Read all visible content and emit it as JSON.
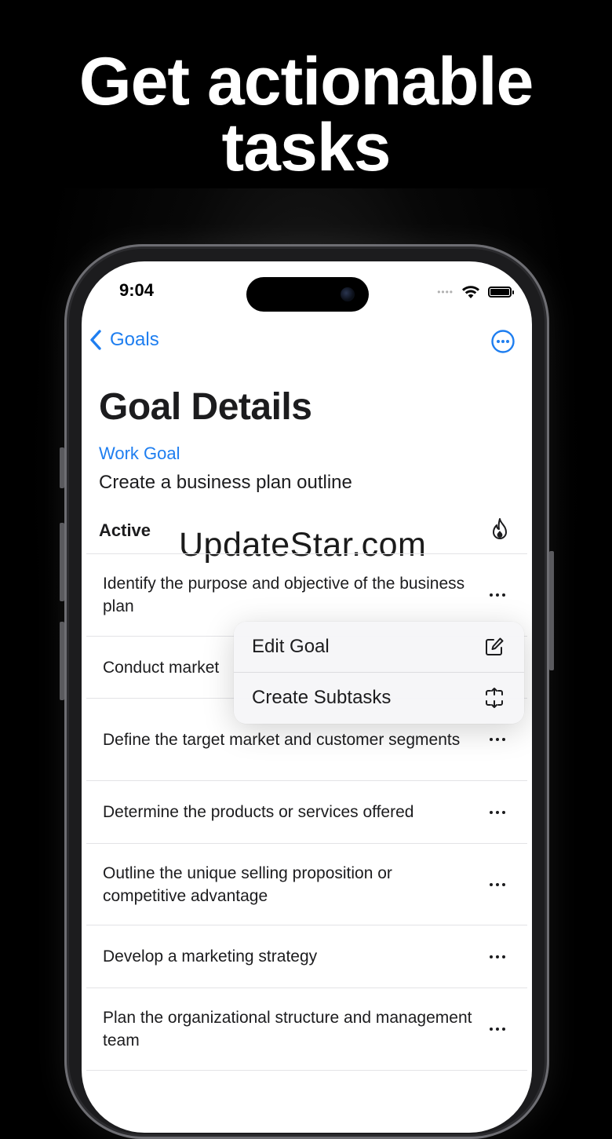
{
  "headline": {
    "line1": "Get actionable",
    "line2": "tasks"
  },
  "status_bar": {
    "time": "9:04",
    "icons": [
      "signal-dots-icon",
      "wifi-icon",
      "battery-icon"
    ]
  },
  "nav": {
    "back_label": "Goals",
    "back_icon": "chevron-left-icon",
    "more_icon": "ellipsis-circle-icon",
    "accent_color": "#1E7EF0"
  },
  "page": {
    "title": "Goal Details",
    "goal_category": "Work Goal",
    "goal_name": "Create a business plan outline"
  },
  "section": {
    "title": "Active",
    "icon": "flame-icon"
  },
  "watermark": "UpdateStar.com",
  "tasks": [
    {
      "text": "Identify the purpose and objective of the business plan"
    },
    {
      "text": "Conduct market"
    },
    {
      "text": "Define the target market and customer segments"
    },
    {
      "text": "Determine the products or services offered"
    },
    {
      "text": "Outline the unique selling proposition or competitive advantage"
    },
    {
      "text": "Develop a marketing strategy"
    },
    {
      "text": "Plan the organizational structure and management team"
    }
  ],
  "context_menu": {
    "items": [
      {
        "label": "Edit Goal",
        "icon": "square-pencil-icon"
      },
      {
        "label": "Create Subtasks",
        "icon": "expand-arrows-icon"
      }
    ]
  }
}
